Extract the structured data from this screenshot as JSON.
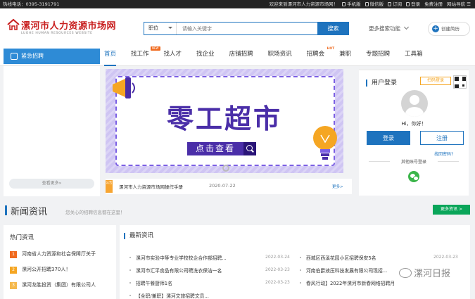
{
  "topbar": {
    "hotline": "热线电话：0395-3191791",
    "welcome": "欢迎来到漯河市人力资源市场网！",
    "links": [
      "手机版",
      "微信版",
      "订阅",
      "登录",
      "免费注册",
      "网站导航"
    ]
  },
  "logo": {
    "title": "漯河市人力资源市场网",
    "sub": "LUOHE HUMAN RESOURCES WEBSITE"
  },
  "search": {
    "select": "职位",
    "placeholder": "请输入关键字",
    "button": "搜索",
    "more": "更多搜索功能"
  },
  "create_resume": "创建简历",
  "nav": {
    "urgent": "紧急招聘",
    "items": [
      {
        "label": "首页",
        "active": true
      },
      {
        "label": "找工作",
        "badge": "NEW"
      },
      {
        "label": "找人才"
      },
      {
        "label": "找企业"
      },
      {
        "label": "店铺招聘"
      },
      {
        "label": "职场资讯"
      },
      {
        "label": "招聘会",
        "badge": "HOT"
      },
      {
        "label": "兼职"
      },
      {
        "label": "专题招聘"
      },
      {
        "label": "工具箱"
      }
    ]
  },
  "left_panel": {
    "view_more": "查看更多»"
  },
  "banner": {
    "title": "零工超市",
    "cta": "点击查看"
  },
  "notice": {
    "tag": "公告",
    "text": "漯河市人力资源市场网操作手册",
    "date": "2020-07-22",
    "more": "更多>"
  },
  "user_box": {
    "title": "用户登录",
    "scan_login": "扫码登录",
    "greeting": "Hi，你好！",
    "login": "登录",
    "register": "注册",
    "forgot": "找回密码?",
    "other_login": "其他账号登录"
  },
  "news": {
    "title": "新闻资讯",
    "subtitle": "您关心的招聘信息都在这里！",
    "more": "更多资讯 >"
  },
  "hot_news": {
    "title": "热门资讯",
    "items": [
      {
        "num": "1",
        "text": "河南省人力资源和社会保障厅关于",
        "color": "#f06a1e"
      },
      {
        "num": "2",
        "text": "漯河公开招聘370人！",
        "color": "#f5a623"
      },
      {
        "num": "3",
        "text": "漯河龙胜投资（集团）有限公司人",
        "color": "#f5b94d"
      }
    ]
  },
  "latest": {
    "title": "最新资讯",
    "left": [
      {
        "text": "漯河市实验中等专业学校校企合作部招聘...",
        "date": "2022-03-24"
      },
      {
        "text": "漯河市汇平食品有限公司聘洗衣保洁一名",
        "date": "2022-03-23"
      },
      {
        "text": "招聘午餐厨师1名",
        "date": "2022-03-23"
      },
      {
        "text": "【全职/兼职】漯河文旅招聘文员...",
        "date": ""
      }
    ],
    "right": [
      {
        "text": "西城区西溪花园小区招聘保安5名",
        "date": "2022-03-23"
      },
      {
        "text": "河南伯爵液压科技发展有限公司现招...",
        "date": ""
      },
      {
        "text": "春风行动】2022年漯河市新春网络招聘月",
        "date": ""
      }
    ]
  },
  "watermark": "漯河日报",
  "colors": {
    "brand": "#1e73be",
    "logo_red": "#c81e1e",
    "news_green": "#0aa65a"
  }
}
